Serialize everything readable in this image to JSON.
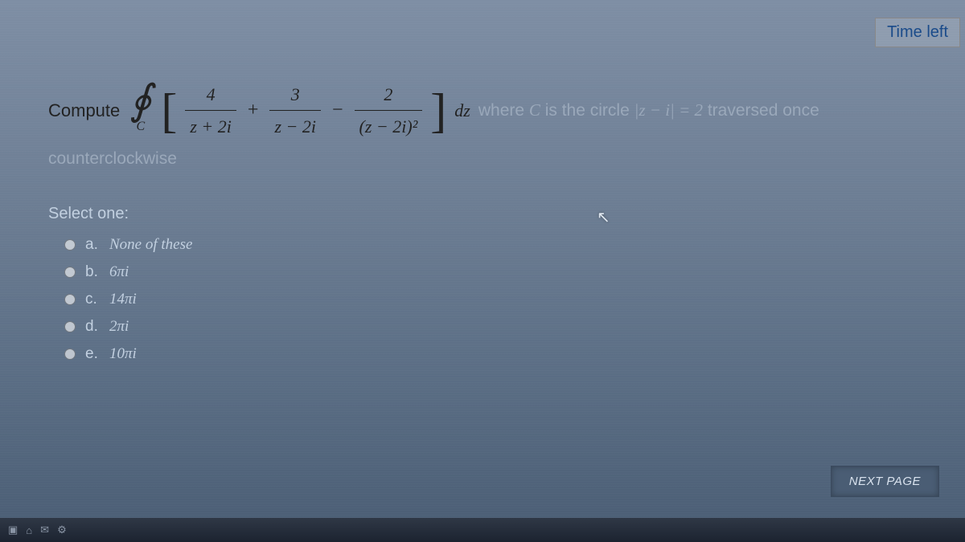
{
  "timer": {
    "label": "Time left"
  },
  "question": {
    "lead": "Compute",
    "integral_sub": "C",
    "frac1_num": "4",
    "frac1_den": "z + 2i",
    "op1": "+",
    "frac2_num": "3",
    "frac2_den": "z − 2i",
    "op2": "−",
    "frac3_num": "2",
    "frac3_den": "(z − 2i)²",
    "dz": "dz",
    "where_prefix": "where ",
    "where_C": "C",
    "where_mid": " is the circle ",
    "where_cond": "|z − i| = 2",
    "where_tail": " traversed once",
    "line2": "counterclockwise"
  },
  "select_label": "Select one:",
  "options": [
    {
      "key": "a.",
      "text": "None of these"
    },
    {
      "key": "b.",
      "text": "6πi"
    },
    {
      "key": "c.",
      "text": "14πi"
    },
    {
      "key": "d.",
      "text": "2πi"
    },
    {
      "key": "e.",
      "text": "10πi"
    }
  ],
  "next_button": "NEXT PAGE",
  "colors": {
    "link": "#1a4b8a",
    "muted": "#9aa8ba"
  }
}
